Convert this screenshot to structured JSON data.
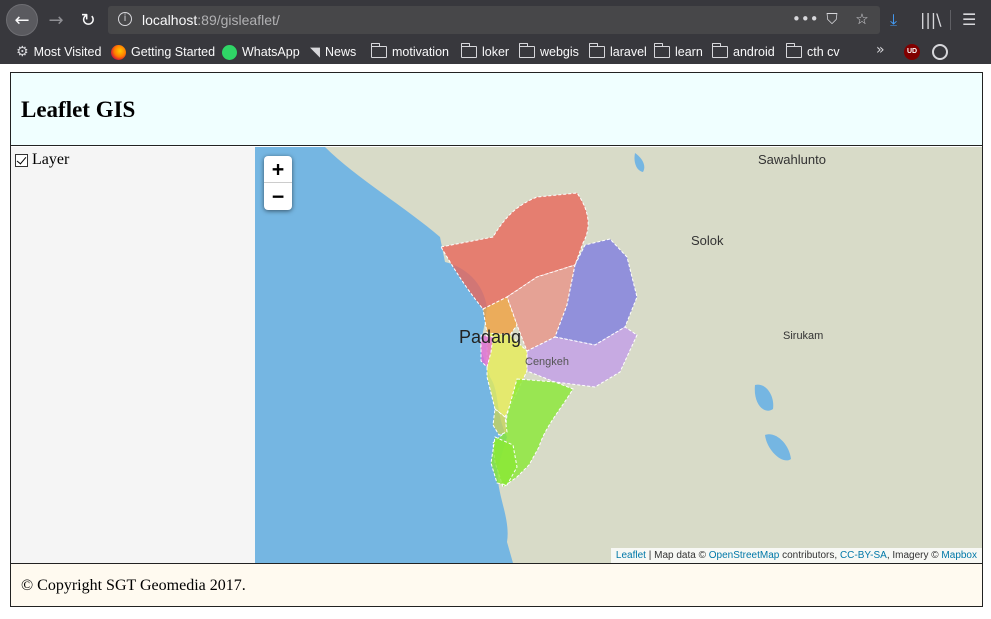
{
  "browser": {
    "url_host": "localhost",
    "url_path": ":89/gisleaflet/",
    "bookmarks": [
      {
        "label": "Most Visited",
        "icon": "gear-icon"
      },
      {
        "label": "Getting Started",
        "icon": "firefox-icon"
      },
      {
        "label": "WhatsApp",
        "icon": "whatsapp-icon"
      },
      {
        "label": "News",
        "icon": "rss-icon"
      },
      {
        "label": "motivation",
        "icon": "folder-icon"
      },
      {
        "label": "loker",
        "icon": "folder-icon"
      },
      {
        "label": "webgis",
        "icon": "folder-icon"
      },
      {
        "label": "laravel",
        "icon": "folder-icon"
      },
      {
        "label": "learn",
        "icon": "folder-icon"
      },
      {
        "label": "android",
        "icon": "folder-icon"
      },
      {
        "label": "cth cv",
        "icon": "folder-icon"
      }
    ],
    "ext_ublock_label": "UD"
  },
  "header": {
    "title": "Leaflet GIS"
  },
  "sidebar": {
    "layer_label": "Layer",
    "layer_checked": true
  },
  "map": {
    "zoom_in": "+",
    "zoom_out": "−",
    "places": {
      "sawahlunto": "Sawahlunto",
      "solok": "Solok",
      "sirukam": "Sirukam",
      "padang": "Padang",
      "cengkeh": "Cengkeh"
    },
    "attribution": {
      "leaflet": "Leaflet",
      "sep1": " | Map data © ",
      "osm": "OpenStreetMap",
      "contrib": " contributors, ",
      "license": "CC-BY-SA",
      "imagery": ", Imagery © ",
      "mapbox": "Mapbox"
    },
    "colors": {
      "sea": "#75b6e2",
      "land": "#d8dbc8",
      "red": "#e8665a",
      "salmon": "#e89488",
      "blue": "#7f7de0",
      "lavender": "#c39ee8",
      "orange": "#f0a040",
      "yellow": "#e7ec58",
      "green": "#8ae834",
      "pink": "#e06ad6",
      "olive": "#c6d25c"
    }
  },
  "footer": {
    "text": "© Copyright SGT Geomedia 2017."
  }
}
